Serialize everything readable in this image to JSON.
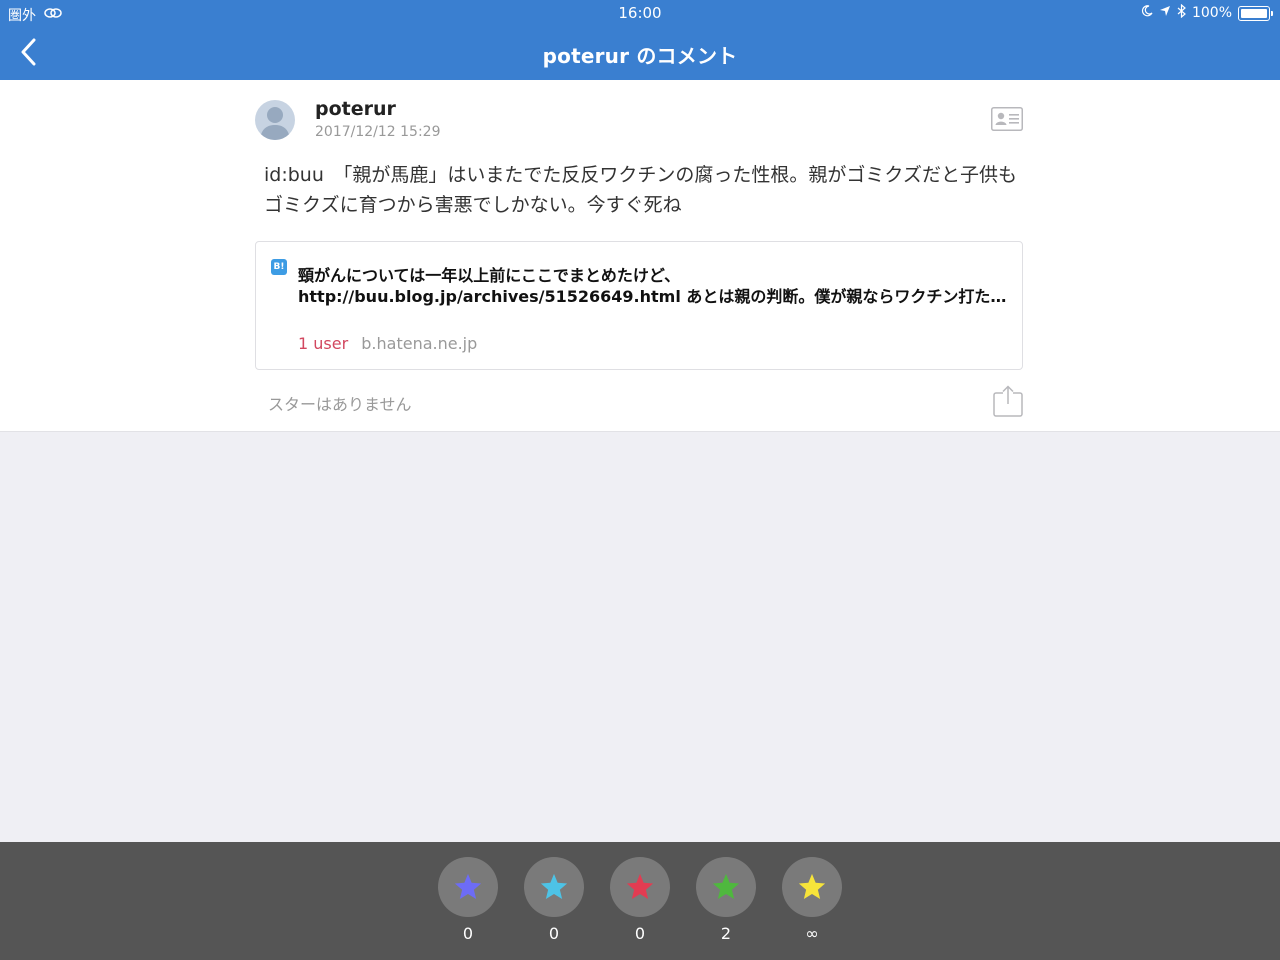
{
  "status_bar": {
    "carrier": "圏外",
    "time": "16:00",
    "battery": "100%"
  },
  "nav": {
    "title": "poterur のコメント",
    "back_icon": "chevron-left-icon"
  },
  "comment": {
    "username": "poterur",
    "timestamp": "2017/12/12 15:29",
    "text": "id:buu　「親が馬鹿」はいまたでた反反ワクチンの腐った性根。親がゴミクズだと子供もゴミクズに育つから害悪でしかない。今すぐ死ね"
  },
  "link_card": {
    "title": "頸がんについては一年以上前にここでまとめたけど、http://buu.blog.jp/archives/51526649.html あとは親の判断。僕が親ならワクチン打たせるけど、他人に無理強いするのは違うと思う",
    "user_count": "1 user",
    "domain": "b.hatena.ne.jp",
    "icon_label": "B!"
  },
  "stars": {
    "none_text": "スターはありません"
  },
  "star_buttons": [
    {
      "color": "#6d6cf6",
      "count": "0"
    },
    {
      "color": "#4dc3e6",
      "count": "0"
    },
    {
      "color": "#e23c52",
      "count": "0"
    },
    {
      "color": "#4fb83e",
      "count": "2"
    },
    {
      "color": "#f7e43a",
      "count": "∞"
    }
  ]
}
